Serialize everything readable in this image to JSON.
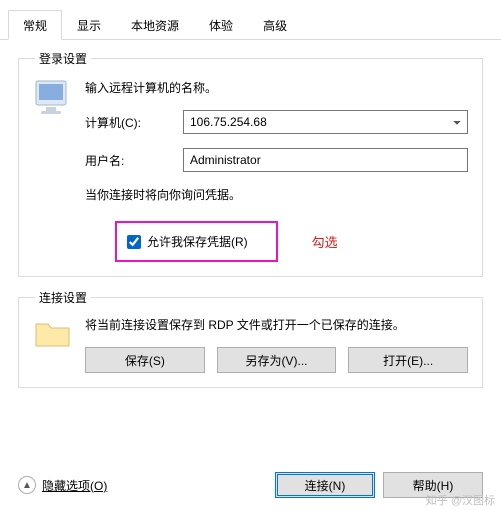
{
  "tabs": [
    "常规",
    "显示",
    "本地资源",
    "体验",
    "高级"
  ],
  "login": {
    "legend": "登录设置",
    "intro": "输入远程计算机的名称。",
    "computer_label": "计算机(C):",
    "computer_value": "106.75.254.68",
    "user_label": "用户名:",
    "user_value": "Administrator",
    "note": "当你连接时将向你询问凭据。",
    "checkbox_label": "允许我保存凭据(R)",
    "annotation": "勾选"
  },
  "conn": {
    "legend": "连接设置",
    "intro": "将当前连接设置保存到 RDP 文件或打开一个已保存的连接。",
    "save": "保存(S)",
    "saveas": "另存为(V)...",
    "open": "打开(E)..."
  },
  "footer": {
    "hide": "隐藏选项(O)",
    "connect": "连接(N)",
    "help": "帮助(H)"
  },
  "watermark": "知乎 @汉图标"
}
